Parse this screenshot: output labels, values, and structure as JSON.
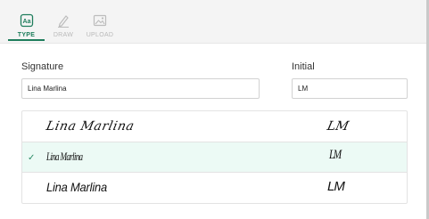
{
  "tabs": [
    {
      "label": "TYPE",
      "icon": "type-text-icon",
      "active": true
    },
    {
      "label": "DRAW",
      "icon": "pen-draw-icon",
      "active": false
    },
    {
      "label": "UPLOAD",
      "icon": "image-upload-icon",
      "active": false
    }
  ],
  "form": {
    "signature_label": "Signature",
    "signature_value": "Lina Marlina",
    "initial_label": "Initial",
    "initial_value": "LM"
  },
  "signature_options": [
    {
      "signature": "Lina Marlina",
      "initial": "LM",
      "selected": false
    },
    {
      "signature": "Lina Marlina",
      "initial": "LM",
      "selected": true
    },
    {
      "signature": "Lina Marlina",
      "initial": "LM",
      "selected": false
    }
  ],
  "colors": {
    "accent": "#1e7d5c",
    "selected_row_bg": "#ecfaf5",
    "inactive_tab": "#b9b9b9"
  }
}
